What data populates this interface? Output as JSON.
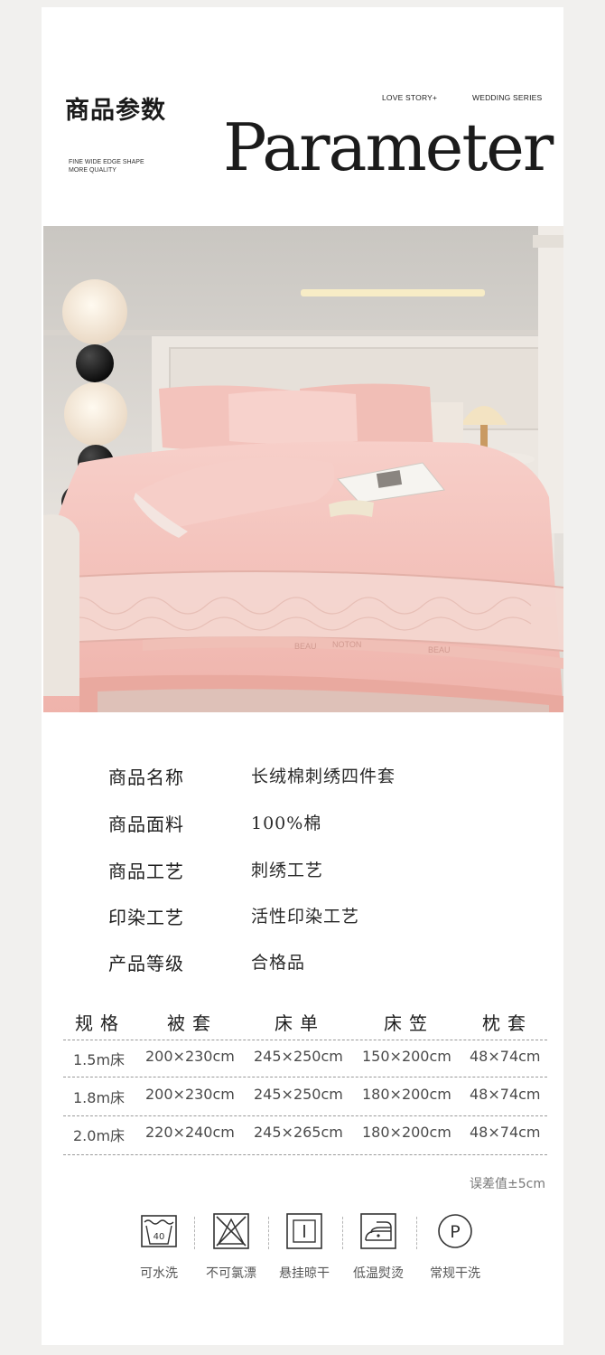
{
  "header": {
    "title_cn": "商品参数",
    "tagline_line1": "FINE WIDE EDGE SHAPE",
    "tagline_line2": "MORE QUALITY",
    "tag_love": "LOVE STORY+",
    "tag_wedding": "WEDDING SERIES",
    "title_en": "Parameter"
  },
  "photo": {
    "pillow_text_left": "BEAU",
    "pillow_text_mid": "NOTON",
    "pillow_text_right": "BEAU"
  },
  "params": [
    {
      "label": "商品名称",
      "value": "长绒棉刺绣四件套"
    },
    {
      "label": "商品面料",
      "value": "100%棉"
    },
    {
      "label": "商品工艺",
      "value": "刺绣工艺"
    },
    {
      "label": "印染工艺",
      "value": "活性印染工艺"
    },
    {
      "label": "产品等级",
      "value": "合格品"
    }
  ],
  "spec_table": {
    "headers": [
      "规格",
      "被套",
      "床单",
      "床笠",
      "枕套"
    ],
    "rows": [
      [
        "1.5m床",
        "200×230cm",
        "245×250cm",
        "150×200cm",
        "48×74cm"
      ],
      [
        "1.8m床",
        "200×230cm",
        "245×250cm",
        "180×200cm",
        "48×74cm"
      ],
      [
        "2.0m床",
        "220×240cm",
        "245×265cm",
        "180×200cm",
        "48×74cm"
      ]
    ],
    "tolerance": "误差值±5cm"
  },
  "care": [
    {
      "icon": "wash-40-icon",
      "label": "可水洗",
      "number": "40"
    },
    {
      "icon": "no-bleach-icon",
      "label": "不可氯漂"
    },
    {
      "icon": "hang-dry-icon",
      "label": "悬挂晾干"
    },
    {
      "icon": "low-iron-icon",
      "label": "低温熨烫"
    },
    {
      "icon": "dry-clean-icon",
      "label": "常规干洗",
      "letter": "P"
    }
  ]
}
